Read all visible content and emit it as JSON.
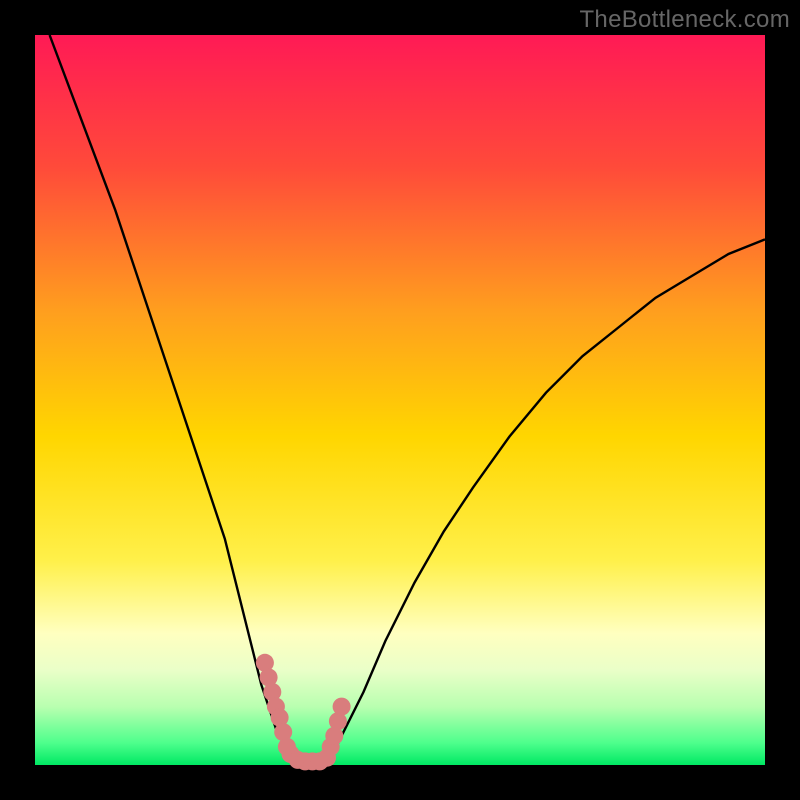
{
  "watermark": "TheBottleneck.com",
  "colors": {
    "frame": "#000000",
    "gradient_top": "#ff1a55",
    "gradient_mid": "#ffe300",
    "gradient_low": "#ffffbb",
    "gradient_band": "#d6ffb7",
    "gradient_bottom": "#00e863",
    "curve": "#000000",
    "dots": "#d97d7d"
  },
  "chart_data": {
    "type": "line",
    "title": "",
    "xlabel": "",
    "ylabel": "",
    "xlim": [
      0,
      100
    ],
    "ylim": [
      0,
      100
    ],
    "series": [
      {
        "name": "left-branch",
        "x": [
          2,
          5,
          8,
          11,
          14,
          17,
          20,
          23,
          26,
          28,
          30,
          31,
          32,
          33,
          34,
          35,
          36
        ],
        "y": [
          100,
          92,
          84,
          76,
          67,
          58,
          49,
          40,
          31,
          23,
          15,
          11,
          8,
          5,
          3,
          1,
          0
        ]
      },
      {
        "name": "right-branch",
        "x": [
          40,
          42,
          45,
          48,
          52,
          56,
          60,
          65,
          70,
          75,
          80,
          85,
          90,
          95,
          100
        ],
        "y": [
          0,
          4,
          10,
          17,
          25,
          32,
          38,
          45,
          51,
          56,
          60,
          64,
          67,
          70,
          72
        ]
      }
    ],
    "dots": {
      "name": "highlight-dots",
      "points": [
        {
          "x": 31.5,
          "y": 14
        },
        {
          "x": 32,
          "y": 12
        },
        {
          "x": 32.5,
          "y": 10
        },
        {
          "x": 33,
          "y": 8
        },
        {
          "x": 33.5,
          "y": 6.5
        },
        {
          "x": 34,
          "y": 4.5
        },
        {
          "x": 34.5,
          "y": 2.5
        },
        {
          "x": 35,
          "y": 1.5
        },
        {
          "x": 36,
          "y": 0.7
        },
        {
          "x": 37,
          "y": 0.5
        },
        {
          "x": 38,
          "y": 0.5
        },
        {
          "x": 39,
          "y": 0.5
        },
        {
          "x": 40,
          "y": 1
        },
        {
          "x": 40.5,
          "y": 2.5
        },
        {
          "x": 41,
          "y": 4
        },
        {
          "x": 41.5,
          "y": 6
        },
        {
          "x": 42,
          "y": 8
        }
      ]
    },
    "notes": "V-shaped bottleneck curve on rainbow heat gradient. No axis ticks or labels visible; all numeric values are estimates from pixel position mapped to a 0–100 normalized range."
  }
}
